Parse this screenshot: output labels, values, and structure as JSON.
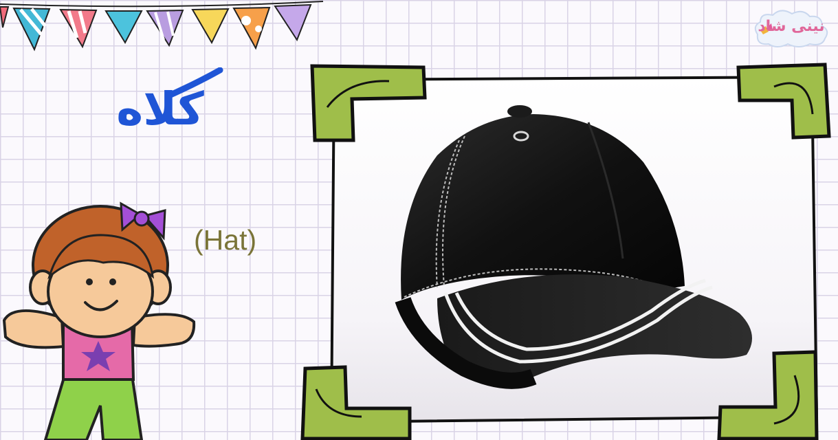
{
  "logo": {
    "text": "نینی شاد"
  },
  "word": {
    "persian": "کلاه",
    "english": "(Hat)"
  },
  "illustration": {
    "subject": "black-baseball-cap"
  },
  "colors": {
    "word": "#1f55d6",
    "translation": "#7a7438",
    "corner_green": "#9fbe4a",
    "cap": "#141414"
  }
}
